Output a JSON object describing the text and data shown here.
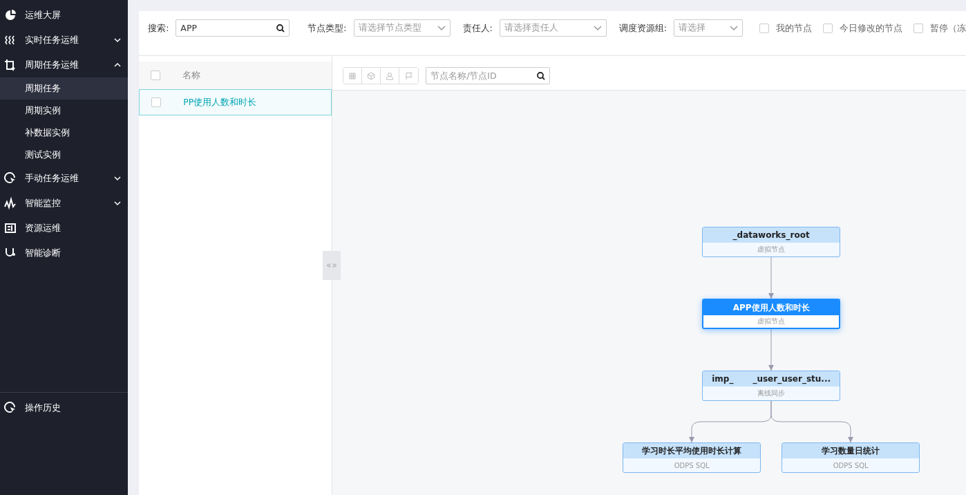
{
  "sidebar": {
    "items": [
      {
        "label": "运维大屏"
      },
      {
        "label": "实时任务运维",
        "expanded": false
      },
      {
        "label": "周期任务运维",
        "expanded": true,
        "children": [
          {
            "label": "周期任务",
            "selected": true
          },
          {
            "label": "周期实例",
            "selected": false
          },
          {
            "label": "补数据实例",
            "selected": false
          },
          {
            "label": "测试实例",
            "selected": false
          }
        ]
      },
      {
        "label": "手动任务运维",
        "expanded": false
      },
      {
        "label": "智能监控",
        "expanded": false
      },
      {
        "label": "资源运维"
      },
      {
        "label": "智能诊断"
      }
    ],
    "footer_item": {
      "label": "操作历史"
    }
  },
  "filters": {
    "search": {
      "label": "搜索:",
      "value": "APP"
    },
    "selects": [
      {
        "label": "节点类型:",
        "placeholder": "请选择节点类型"
      },
      {
        "label": "责任人:",
        "placeholder": "请选择责任人"
      },
      {
        "label": "调度资源组:",
        "placeholder": "请选择"
      }
    ],
    "checkboxes": [
      {
        "label": "我的节点",
        "checked": false
      },
      {
        "label": "今日修改的节点",
        "checked": false
      },
      {
        "label": "暂停（冻",
        "checked": false
      }
    ]
  },
  "list": {
    "header": "名称",
    "header_checked": false,
    "rows": [
      {
        "name": "PP使用人数和时长",
        "selected": true,
        "checked": false
      }
    ]
  },
  "canvas": {
    "search_placeholder": "节点名称/节点ID",
    "root": {
      "title": "_dataworks_root",
      "subtitle": "虚拟节点",
      "selected": false,
      "children": [
        {
          "title": "APP使用人数和时长",
          "subtitle": "虚拟节点",
          "selected": true,
          "children": [
            {
              "title": "imp_",
              "title_end": "_user_user_stu...",
              "subtitle": "离线同步",
              "selected": false,
              "children": [
                {
                  "title": "学习时长平均使用时长计算",
                  "subtitle": "ODPS SQL",
                  "selected": false
                },
                {
                  "title": "学习数量日统计",
                  "subtitle": "ODPS SQL",
                  "selected": false
                }
              ]
            }
          ]
        }
      ]
    }
  }
}
